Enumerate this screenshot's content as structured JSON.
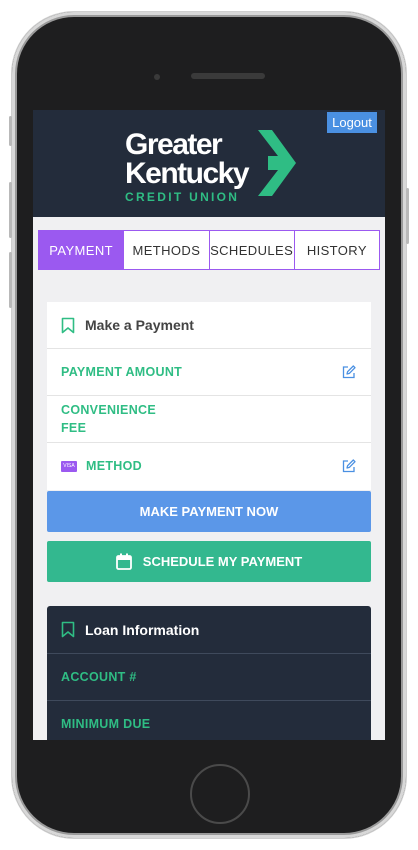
{
  "header": {
    "logout_label": "Logout",
    "logo_line1": "Greater",
    "logo_line2": "Kentucky",
    "logo_sub": "CREDIT UNION"
  },
  "tabs": [
    {
      "label": "PAYMENT",
      "active": true
    },
    {
      "label": "METHODS",
      "active": false
    },
    {
      "label": "SCHEDULES",
      "active": false
    },
    {
      "label": "HISTORY",
      "active": false
    }
  ],
  "payment_card": {
    "title": "Make a Payment",
    "amount_label": "PAYMENT AMOUNT",
    "fee_label_1": "CONVENIENCE",
    "fee_label_2": "FEE",
    "method_label": "METHOD",
    "card_badge": "VISA"
  },
  "buttons": {
    "make_payment": "MAKE PAYMENT NOW",
    "schedule": "SCHEDULE MY PAYMENT"
  },
  "loan_card": {
    "title": "Loan Information",
    "account_label": "ACCOUNT #",
    "minimum_label": "MINIMUM DUE"
  },
  "colors": {
    "accent_purple": "#9b59f0",
    "brand_green": "#2fbd84",
    "header_navy": "#232c3b",
    "button_blue": "#5b97e8",
    "button_green": "#33b88f"
  },
  "icons": [
    "bookmark-icon",
    "edit-icon",
    "visa-card-icon",
    "calendar-icon",
    "chevron-logo-icon"
  ]
}
